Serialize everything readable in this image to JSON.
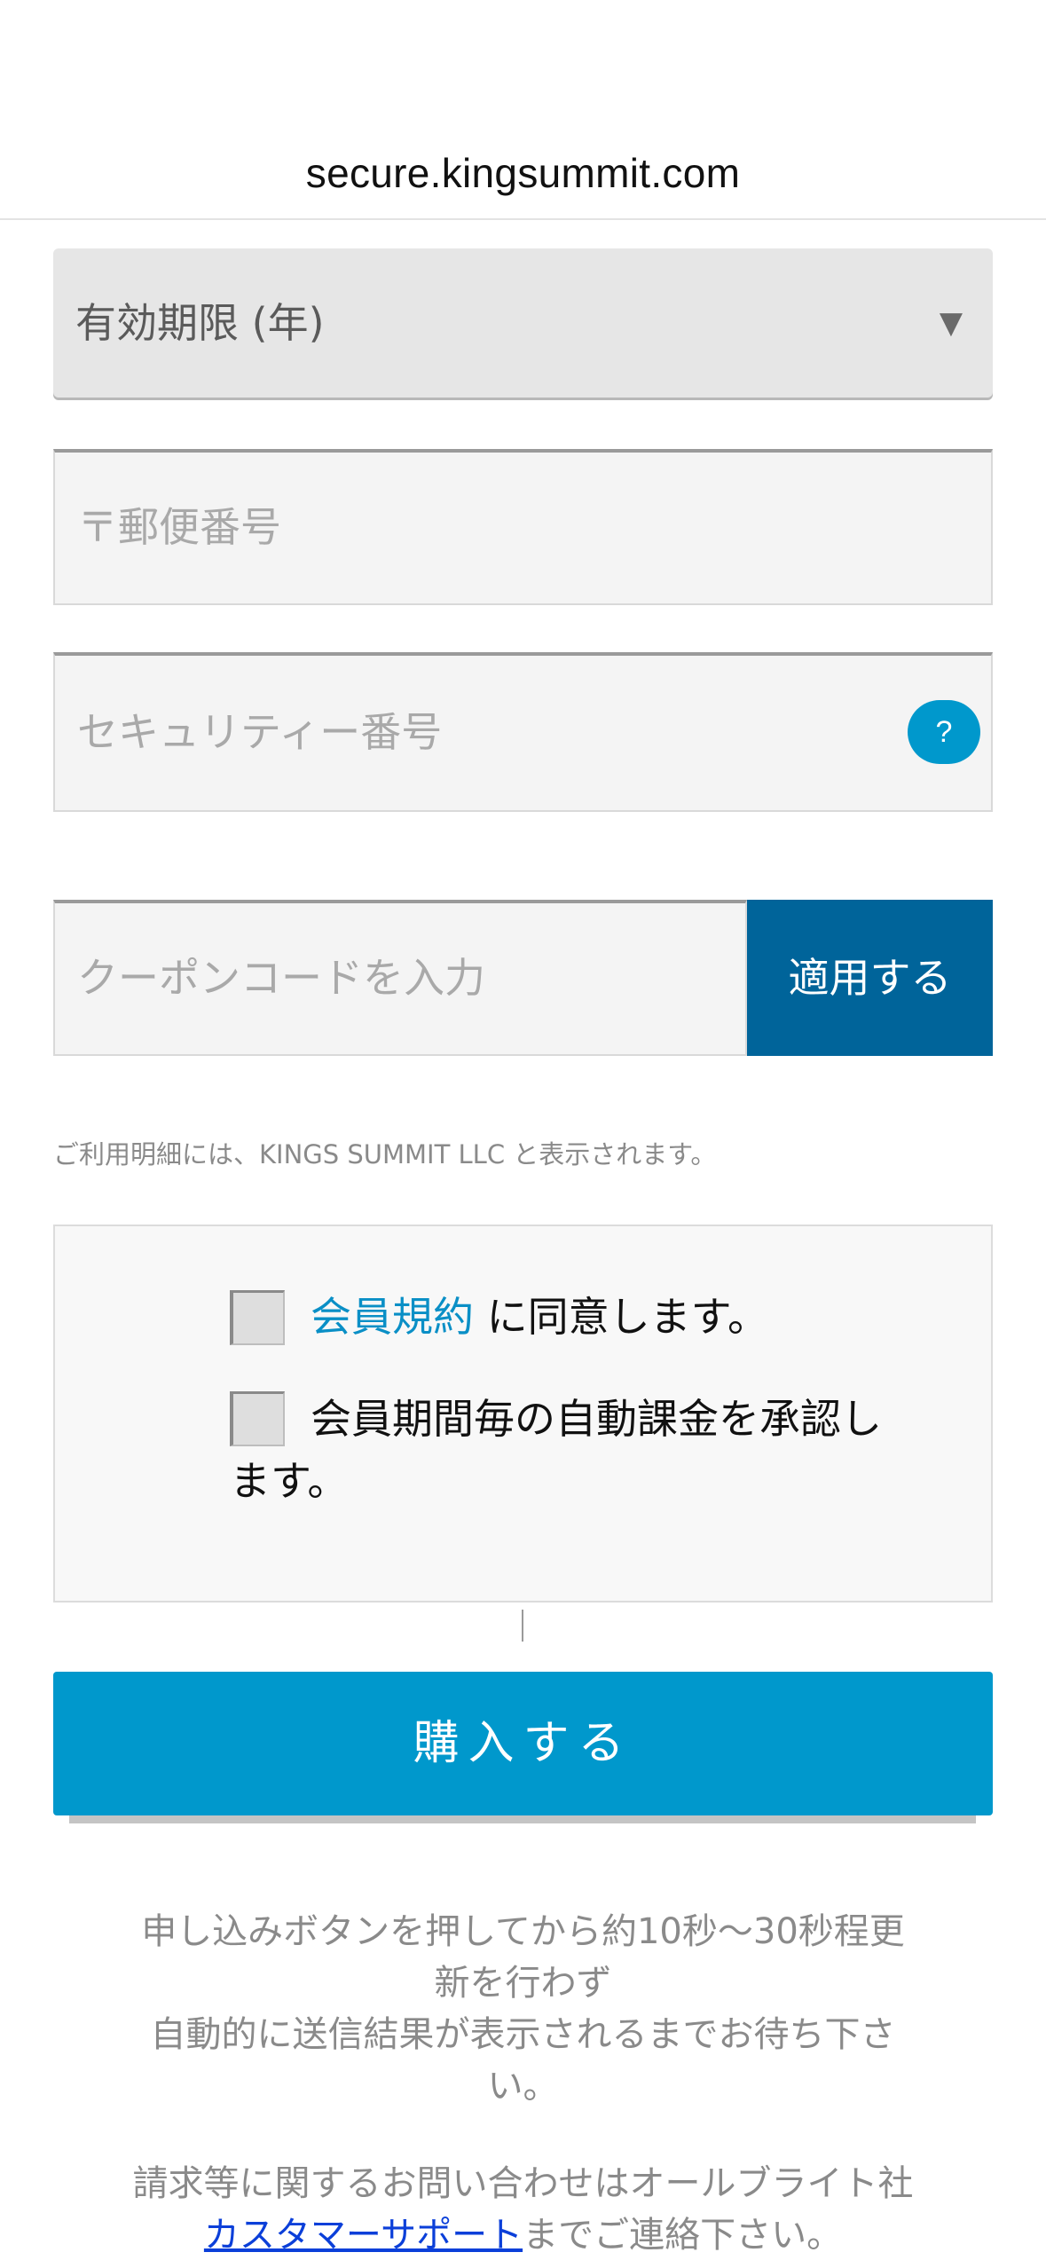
{
  "browser": {
    "url": "secure.kingsummit.com"
  },
  "form": {
    "expiry_year_select": {
      "selected": "有効期限 (年)"
    },
    "postal_code": {
      "placeholder": "〒郵便番号"
    },
    "security_code": {
      "placeholder": "セキュリティー番号",
      "help_label": "?"
    },
    "coupon": {
      "placeholder": "クーポンコードを入力",
      "apply_label": "適用する"
    },
    "statement_note": "ご利用明細には、KINGS SUMMIT LLC と表示されます。"
  },
  "agreements": {
    "terms_link": "会員規約",
    "terms_suffix": " に同意します。",
    "auto_billing_line1": "会員期間毎の自動課金を承認し",
    "auto_billing_line2": "ます。"
  },
  "purchase": {
    "button_label": "購入する"
  },
  "notices": {
    "wait_line1": "申し込みボタンを押してから約10秒〜30秒程更",
    "wait_line2": "新を行わず",
    "wait_line3": "自動的に送信結果が表示されるまでお待ち下さ",
    "wait_line4": "い。",
    "contact_line1": "請求等に関するお問い合わせはオールブライト社",
    "contact_link": "カスタマーサポート",
    "contact_suffix": "までご連絡下さい。"
  },
  "colors": {
    "accent": "#0098cc",
    "apply_button": "#00649a",
    "link": "#0a8fc6",
    "support_link": "#0b3fd9"
  },
  "icons": {
    "select_caret": "triangle-down",
    "help": "question-mark-circle"
  }
}
